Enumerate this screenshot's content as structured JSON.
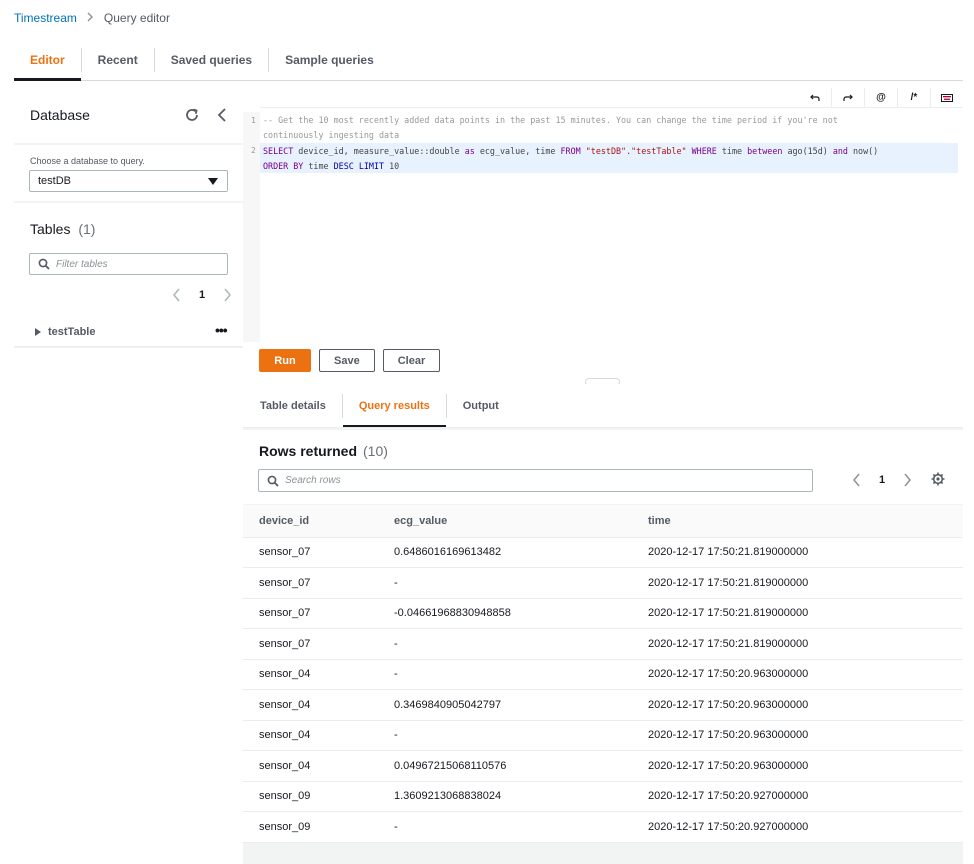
{
  "breadcrumb": {
    "root": "Timestream",
    "current": "Query editor"
  },
  "main_tabs": [
    "Editor",
    "Recent",
    "Saved queries",
    "Sample queries"
  ],
  "sidebar": {
    "title": "Database",
    "database_label": "Choose a database to query.",
    "database_value": "testDB",
    "tables_title": "Tables",
    "tables_count": "(1)",
    "filter_placeholder": "Filter tables",
    "page": "1",
    "tables": [
      "testTable"
    ]
  },
  "toolbar": {
    "undo": "undo-icon",
    "redo": "redo-icon",
    "at": "@",
    "comment": "/*",
    "keyboard": "keyboard-icon"
  },
  "editor": {
    "line_numbers": [
      "1",
      "2"
    ],
    "comment_line_a": "-- Get the 10 most recently added data points in the past 15 minutes. You can change the time period if you're not",
    "comment_line_b": "continuously ingesting data",
    "sql": {
      "select": "SELECT",
      "select_cols": " device_id, measure_value::double ",
      "as": "as",
      "after_as": " ecg_value, time ",
      "from": "FROM",
      "table": "\"testDB\".\"testTable\"",
      "where": "WHERE",
      "where_col": " time ",
      "between": "between",
      "ago": " ago(15d) ",
      "and": "and",
      "now": " now()",
      "order": "ORDER BY",
      "order_col": " time ",
      "desc": "DESC",
      "limit": "LIMIT",
      "limit_val": " 10"
    }
  },
  "actions": {
    "run": "Run",
    "save": "Save",
    "clear": "Clear"
  },
  "result_tabs": [
    "Table details",
    "Query results",
    "Output"
  ],
  "results": {
    "title": "Rows returned",
    "count": "(10)",
    "search_placeholder": "Search rows",
    "page": "1",
    "columns": [
      "device_id",
      "ecg_value",
      "time"
    ],
    "rows": [
      [
        "sensor_07",
        "0.6486016169613482",
        "2020-12-17 17:50:21.819000000"
      ],
      [
        "sensor_07",
        "-",
        "2020-12-17 17:50:21.819000000"
      ],
      [
        "sensor_07",
        "-0.04661968830948858",
        "2020-12-17 17:50:21.819000000"
      ],
      [
        "sensor_07",
        "-",
        "2020-12-17 17:50:21.819000000"
      ],
      [
        "sensor_04",
        "-",
        "2020-12-17 17:50:20.963000000"
      ],
      [
        "sensor_04",
        "0.3469840905042797",
        "2020-12-17 17:50:20.963000000"
      ],
      [
        "sensor_04",
        "-",
        "2020-12-17 17:50:20.963000000"
      ],
      [
        "sensor_04",
        "0.04967215068110576",
        "2020-12-17 17:50:20.963000000"
      ],
      [
        "sensor_09",
        "1.3609213068838024",
        "2020-12-17 17:50:20.927000000"
      ],
      [
        "sensor_09",
        "-",
        "2020-12-17 17:50:20.927000000"
      ]
    ]
  },
  "colors": {
    "accent": "#ec7211",
    "link": "#0073bb",
    "text": "#16191f",
    "muted": "#545b64"
  }
}
